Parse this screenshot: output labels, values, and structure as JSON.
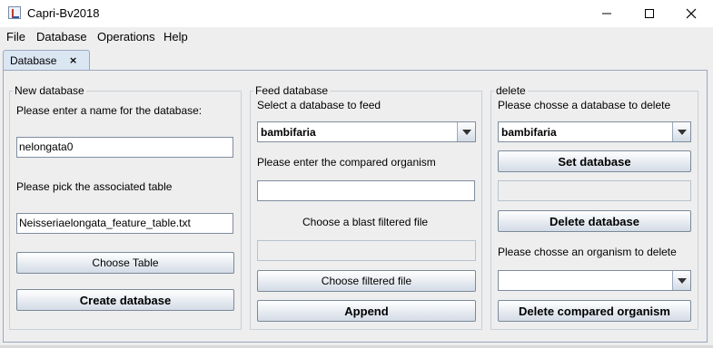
{
  "window": {
    "title": "Capri-Bv2018",
    "minimize": "minimize",
    "maximize": "maximize",
    "close": "close"
  },
  "menubar": {
    "items": [
      "File",
      "Database",
      "Operations",
      "Help"
    ]
  },
  "tab": {
    "label": "Database",
    "close_glyph": "×"
  },
  "new_database": {
    "legend": "New database",
    "name_prompt": "Please enter a name for the database:",
    "name_value": "nelongata0",
    "table_prompt": "Please pick the associated table",
    "table_value": "Neisseriaelongata_feature_table.txt",
    "choose_table_button": "Choose Table",
    "create_button": "Create database"
  },
  "feed_database": {
    "legend": "Feed database",
    "select_prompt": "Select a database to feed",
    "selected_db": "bambifaria",
    "organism_prompt": "Please enter the compared organism",
    "organism_value": "",
    "blast_prompt": "Choose a blast filtered file",
    "blast_value": "",
    "choose_file_button": "Choose filtered file",
    "append_button": "Append"
  },
  "delete": {
    "legend": "delete",
    "db_prompt": "Please chosse a database to delete",
    "selected_db": "bambifaria",
    "set_button": "Set database",
    "set_value": "",
    "delete_db_button": "Delete database",
    "organism_prompt": "Please chosse an organism to delete",
    "selected_organism": "",
    "delete_organism_button": "Delete compared organism"
  },
  "colors": {
    "button_gradient_top": "#ffffff",
    "button_gradient_bottom": "#d3dbe6",
    "tab_bg": "#dbe6f3",
    "panel_bg": "#eeeeee"
  }
}
